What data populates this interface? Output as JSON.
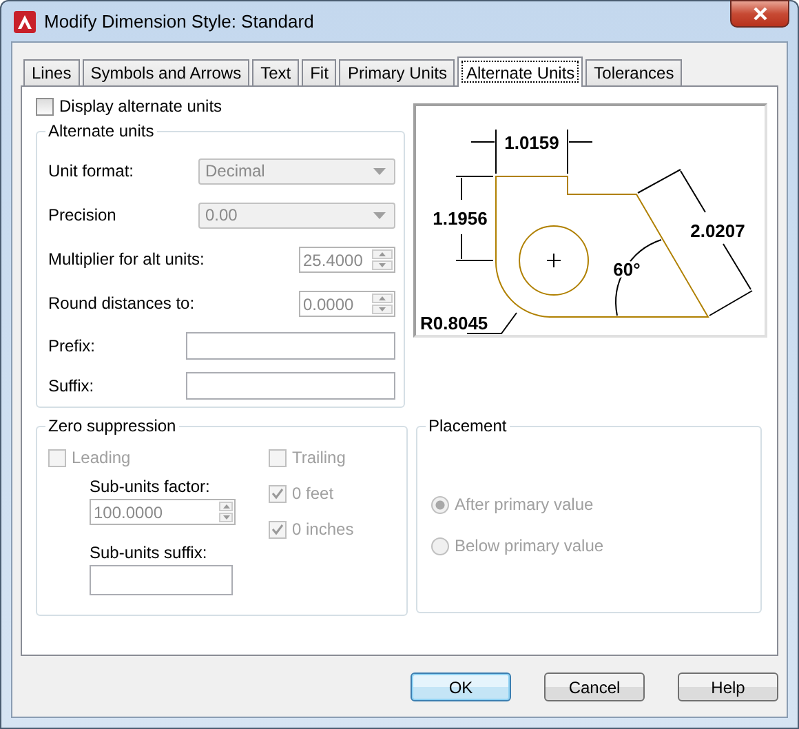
{
  "window": {
    "title": "Modify Dimension Style: Standard"
  },
  "tabs": [
    {
      "label": "Lines",
      "selected": false
    },
    {
      "label": "Symbols and Arrows",
      "selected": false
    },
    {
      "label": "Text",
      "selected": false
    },
    {
      "label": "Fit",
      "selected": false
    },
    {
      "label": "Primary Units",
      "selected": false
    },
    {
      "label": "Alternate Units",
      "selected": true
    },
    {
      "label": "Tolerances",
      "selected": false
    }
  ],
  "display_alternate_units": {
    "label": "Display alternate units",
    "checked": false
  },
  "alternate_units": {
    "title": "Alternate units",
    "fields": [
      {
        "kind": "dropdown",
        "label": "Unit format:",
        "value": "Decimal"
      },
      {
        "kind": "dropdown",
        "label": "Precision",
        "value": "0.00"
      },
      {
        "kind": "spinner",
        "label": "Multiplier for alt units:",
        "value": "25.4000"
      },
      {
        "kind": "spinner",
        "label": "Round distances  to:",
        "value": "0.0000"
      },
      {
        "kind": "text",
        "label": "Prefix:"
      },
      {
        "kind": "text",
        "label": "Suffix:"
      }
    ]
  },
  "preview": {
    "labels": [
      "1.0159",
      "1.1956",
      "2.0207",
      "60°",
      "R0.8045"
    ]
  },
  "zero_suppression": {
    "title": "Zero suppression",
    "leading": {
      "label": "Leading",
      "checked": false
    },
    "trailing": {
      "label": "Trailing",
      "checked": false
    },
    "sub_units_factor": {
      "label": "Sub-units factor:",
      "value": "100.0000"
    },
    "feet": {
      "label": "0 feet",
      "checked": true
    },
    "inches": {
      "label": "0 inches",
      "checked": true
    },
    "sub_units_suffix": {
      "label": "Sub-units suffix:"
    }
  },
  "placement": {
    "title": "Placement",
    "options": [
      {
        "label": "After primary value",
        "selected": true
      },
      {
        "label": "Below primary value",
        "selected": false
      }
    ]
  },
  "buttons": [
    {
      "label": "OK",
      "default": true
    },
    {
      "label": "Cancel",
      "default": false
    },
    {
      "label": "Help",
      "default": false
    }
  ]
}
